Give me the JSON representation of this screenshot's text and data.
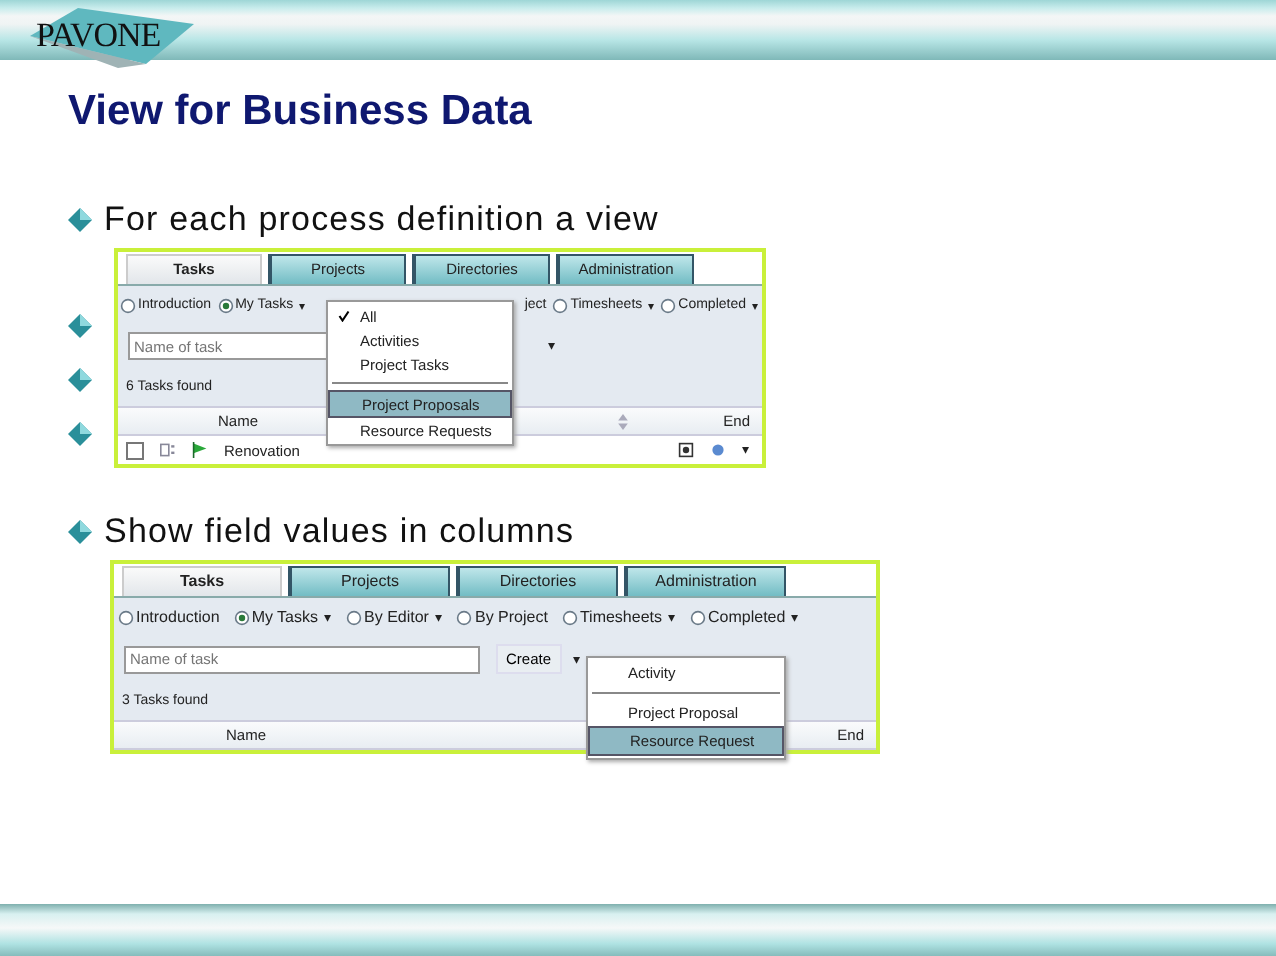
{
  "header": {
    "logo": "PAVONE"
  },
  "title": "View for Business Data",
  "points": [
    {
      "text": "For each process definition a view",
      "covered_bullets": [
        {
          "kind": "bullet"
        },
        {
          "kind": "bullet"
        },
        {
          "kind": "bullet"
        }
      ],
      "screen": {
        "tabs": [
          {
            "label": "Tasks",
            "selected": true
          },
          {
            "label": "Projects",
            "selected": false
          },
          {
            "label": "Directories",
            "selected": false
          },
          {
            "label": "Administration",
            "selected": false
          }
        ],
        "views": [
          {
            "kind": "radio",
            "label": "Introduction",
            "selected": false
          },
          {
            "kind": "radio",
            "label": "My Tasks",
            "selected": true,
            "caret": "▾"
          },
          {
            "kind": "covered"
          },
          {
            "kind": "fragment",
            "label": "ject"
          },
          {
            "kind": "radio",
            "label": "Timesheets",
            "selected": false,
            "caret": "▾"
          },
          {
            "kind": "radio",
            "label": "Completed",
            "selected": false,
            "caret": "▾"
          }
        ],
        "search": {
          "placeholder": "Name of task"
        },
        "create_caret": "▾",
        "count": "6 Tasks found",
        "columns": [
          "Name",
          "End"
        ],
        "sortable": true,
        "rows": [
          {
            "name": "Renovation",
            "checked": false,
            "caret": "▾"
          }
        ],
        "menu": [
          {
            "kind": "item",
            "label": "All",
            "checked": true,
            "selected": false
          },
          {
            "kind": "item",
            "label": "Activities",
            "checked": false,
            "selected": false
          },
          {
            "kind": "item",
            "label": "Project Tasks",
            "checked": false,
            "selected": false
          },
          {
            "kind": "separator"
          },
          {
            "kind": "item",
            "label": "Project Proposals",
            "checked": false,
            "selected": true
          },
          {
            "kind": "item",
            "label": "Resource Requests",
            "checked": false,
            "selected": false
          }
        ]
      }
    },
    {
      "text": "Show field values in columns",
      "screen": {
        "tabs": [
          {
            "label": "Tasks",
            "selected": true
          },
          {
            "label": "Projects",
            "selected": false
          },
          {
            "label": "Directories",
            "selected": false
          },
          {
            "label": "Administration",
            "selected": false
          }
        ],
        "views": [
          {
            "kind": "radio",
            "label": "Introduction",
            "selected": false
          },
          {
            "kind": "radio",
            "label": "My Tasks",
            "selected": true,
            "caret": "▾"
          },
          {
            "kind": "radio",
            "label": "By Editor",
            "selected": false,
            "caret": "▾"
          },
          {
            "kind": "radio",
            "label": "By Project",
            "selected": false
          },
          {
            "kind": "radio",
            "label": "Timesheets",
            "selected": false,
            "caret": "▾"
          },
          {
            "kind": "radio",
            "label": "Completed",
            "selected": false,
            "caret": "▾"
          }
        ],
        "search": {
          "placeholder": "Name of task"
        },
        "create_button": "Create",
        "create_caret": "▾",
        "count": "3 Tasks found",
        "columns": [
          "Name",
          "End"
        ],
        "sortable": false,
        "menu": [
          {
            "kind": "item",
            "label": "Activity",
            "checked": false,
            "selected": false
          },
          {
            "kind": "separator"
          },
          {
            "kind": "item",
            "label": "Project Proposal",
            "checked": false,
            "selected": false
          },
          {
            "kind": "item",
            "label": "Resource Request",
            "checked": false,
            "selected": true
          }
        ]
      }
    }
  ]
}
